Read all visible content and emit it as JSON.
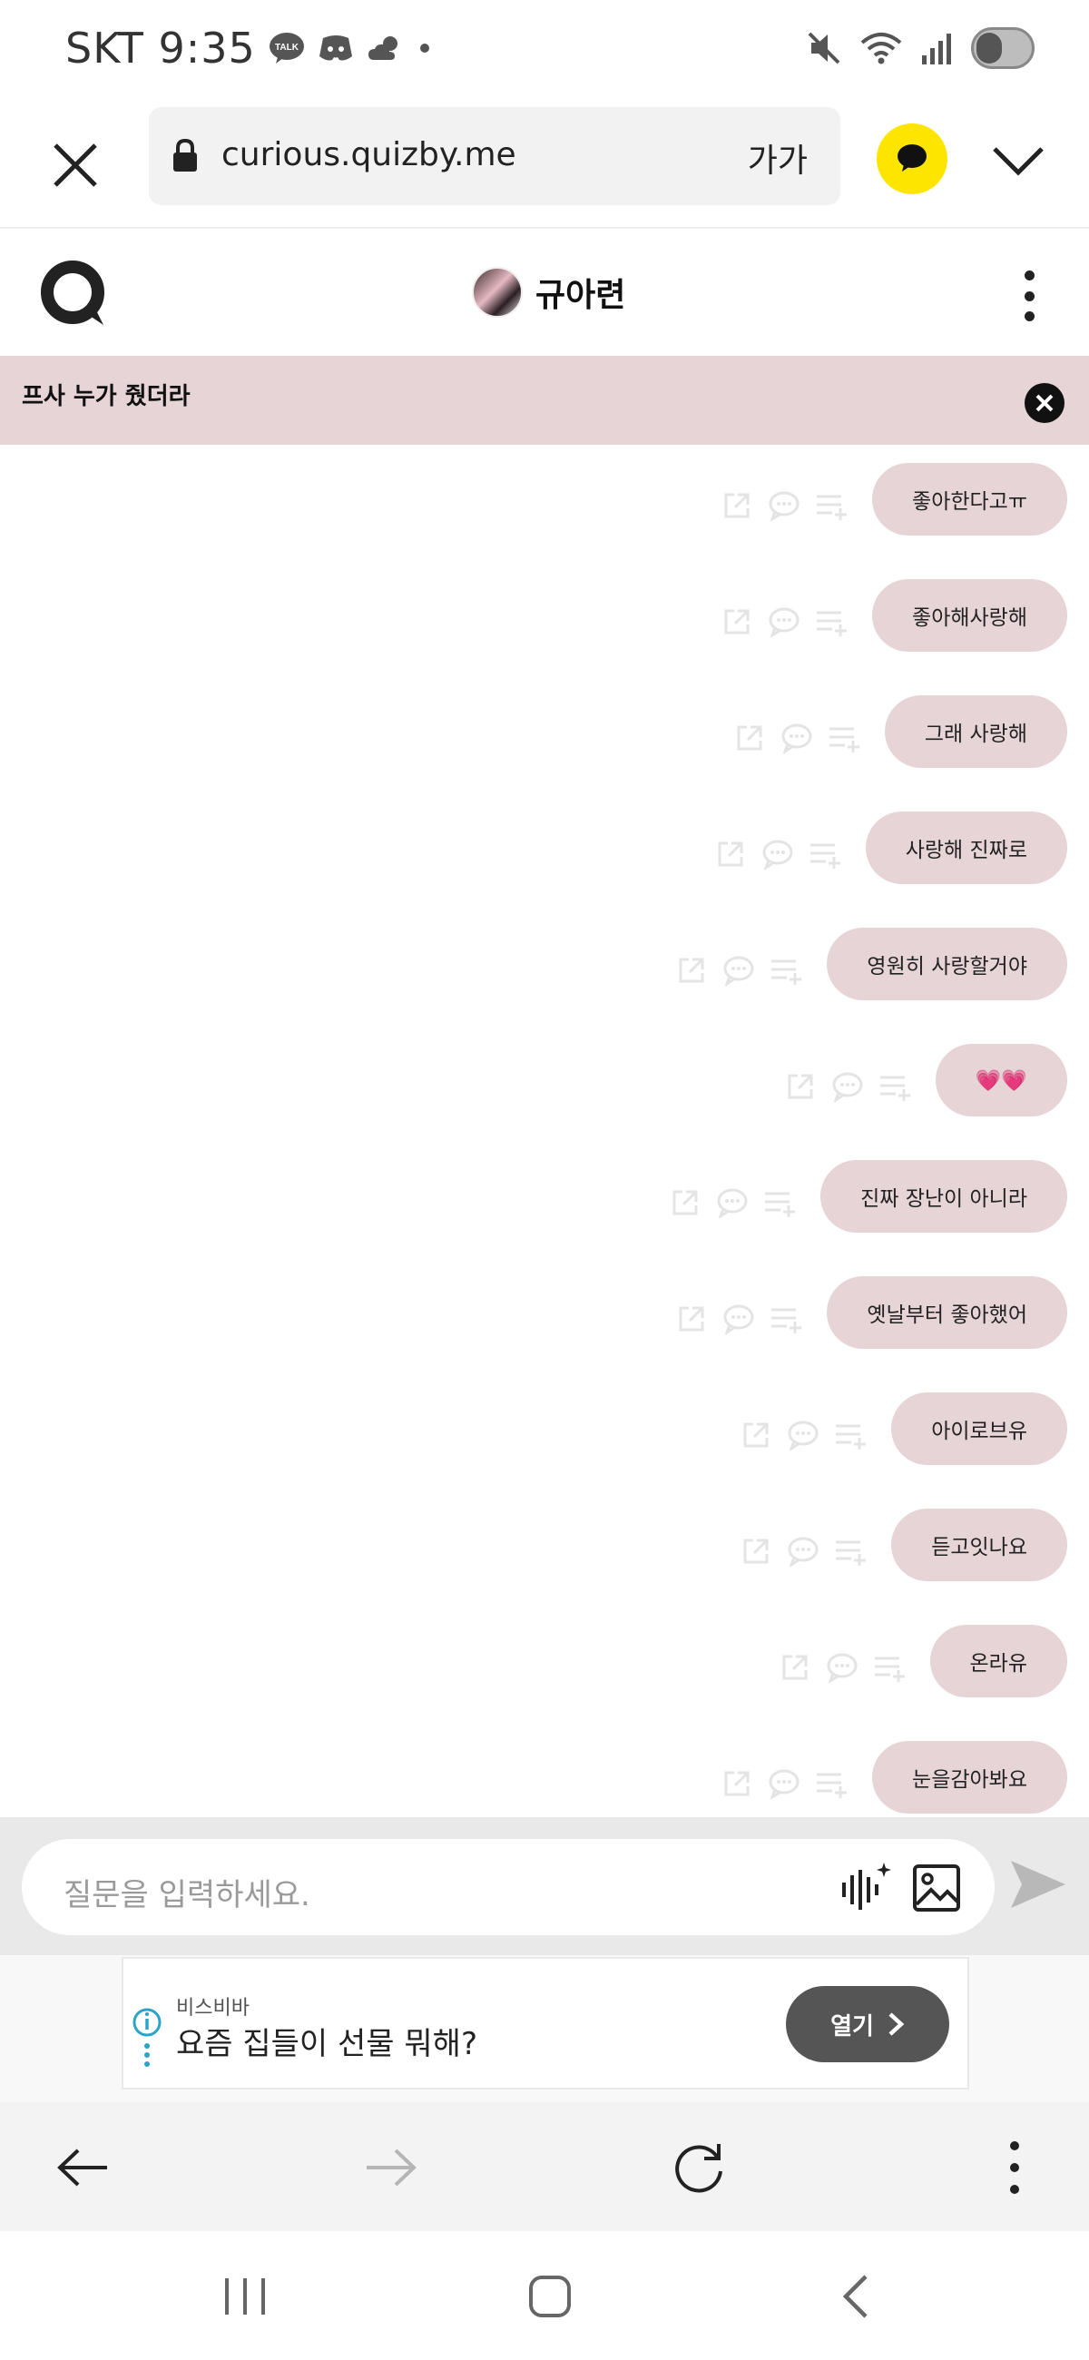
{
  "status_bar": {
    "carrier_time": "SKT 9:35",
    "left_icons": [
      "talk-icon",
      "discord-icon",
      "weather-icon",
      "dot-icon"
    ],
    "right_icons": [
      "mute-icon",
      "wifi-icon",
      "signal-icon",
      "battery-icon"
    ]
  },
  "browser": {
    "url": "curious.quizby.me",
    "text_size_label": "가가",
    "kakao_color": "#fee500"
  },
  "header": {
    "profile_name": "규아련"
  },
  "notice": {
    "text": "프사 누가 줬더라"
  },
  "messages": [
    {
      "text": "좋아한다고ㅠ"
    },
    {
      "text": "좋아해사랑해"
    },
    {
      "text": "그래 사랑해"
    },
    {
      "text": "사랑해 진짜로"
    },
    {
      "text": "영원히 사랑할거야"
    },
    {
      "text": "💗💗"
    },
    {
      "text": "진짜 장난이 아니라"
    },
    {
      "text": "옛날부터 좋아했어"
    },
    {
      "text": "아이로브유"
    },
    {
      "text": "듣고잇나요"
    },
    {
      "text": "온라유"
    },
    {
      "text": "눈을감아봐요"
    }
  ],
  "input": {
    "placeholder": "질문을 입력하세요."
  },
  "ad": {
    "sponsor": "비스비바",
    "title": "요즘 집들이 선물 뭐해?",
    "open_label": "열기"
  },
  "colors": {
    "bubble": "#e6d4d6",
    "notice": "#e6d4d6",
    "accent_yellow": "#fee500"
  }
}
